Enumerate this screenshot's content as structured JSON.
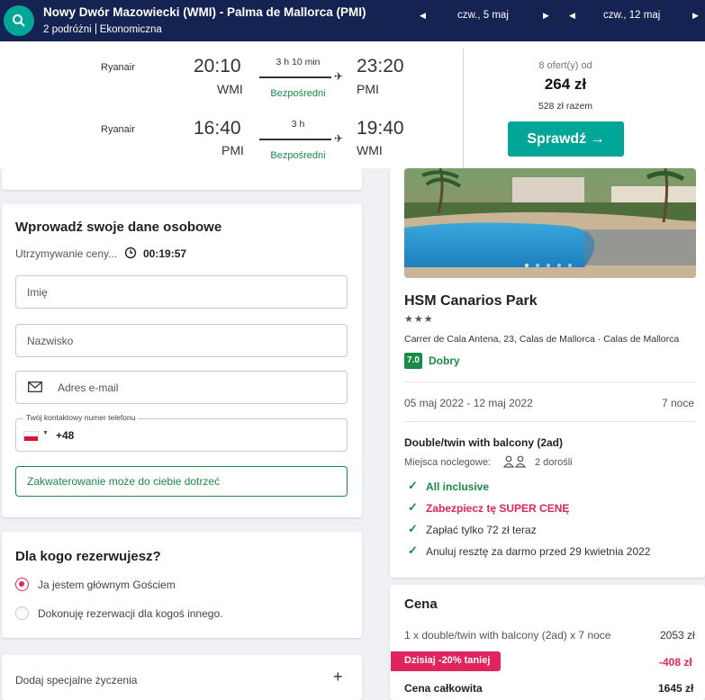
{
  "header": {
    "route": "Nowy Dwór Mazowiecki (WMI) - Palma de Mallorca (PMI)",
    "travellers": "2 podróżni",
    "cabin": "Ekonomiczna",
    "date_out": "czw., 5 maj",
    "date_back": "czw., 12 maj"
  },
  "flights": [
    {
      "airline": "Ryanair",
      "dep_time": "20:10",
      "dep_code": "WMI",
      "duration": "3 h 10 min",
      "stops": "Bezpośredni",
      "arr_time": "23:20",
      "arr_code": "PMI"
    },
    {
      "airline": "Ryanair",
      "dep_time": "16:40",
      "dep_code": "PMI",
      "duration": "3 h",
      "stops": "Bezpośredni",
      "arr_time": "19:40",
      "arr_code": "WMI"
    }
  ],
  "offer": {
    "count_text": "8 ofert(y) od",
    "price": "264 zł",
    "total": "528 zł razem",
    "button": "Sprawdź →"
  },
  "personal": {
    "title": "Wprowadź swoje dane osobowe",
    "hold_label": "Utrzymywanie ceny...",
    "timer": "00:19:57",
    "first_name_ph": "Imię",
    "last_name_ph": "Nazwisko",
    "email_ph": "Adres e-mail",
    "phone_label": "Twój kontaktowy numer telefonu",
    "phone_prefix": "+48",
    "note": "Zakwaterowanie może do ciebie dotrzeć"
  },
  "booking_for": {
    "title": "Dla kogo rezerwujesz?",
    "option_main": "Ja jestem głównym Gościem",
    "option_other": "Dokonuję rezerwacji dla kogoś innego."
  },
  "special": {
    "label": "Dodaj specjalne życzenia",
    "icon": "+"
  },
  "hotel": {
    "name": "HSM Canarios Park",
    "stars": "★★★",
    "address": "Carrer de Cala Antena, 23, Calas de Mallorca · Calas de Mallorca",
    "score": "7.0",
    "score_label": "Dobry",
    "dates": "05 maj 2022 - 12 maj 2022",
    "nights": "7 noce",
    "room": "Double/twin with balcony (2ad)",
    "beds_label": "Miejsca noclegowe:",
    "guests": "2 dorośli",
    "perks": [
      {
        "text": "All inclusive"
      },
      {
        "text": "Zabezpiecz tę SUPER CENĘ"
      },
      {
        "text": "Zapłać tylko 72 zł teraz"
      },
      {
        "text": "Anuluj resztę za darmo przed 29 kwietnia 2022"
      }
    ]
  },
  "price_box": {
    "title": "Cena",
    "line_label": "1 x double/twin with balcony (2ad) x 7 noce",
    "line_value": "2053 zł",
    "discount_label": "Dzisiaj -20% taniej",
    "discount_value": "-408 zł",
    "total_label": "Cena całkowita",
    "total_value": "1645 zł"
  },
  "colors": {
    "navy": "#142351",
    "teal": "#00a698",
    "green": "#1a8a4a",
    "pink": "#e0245e"
  }
}
